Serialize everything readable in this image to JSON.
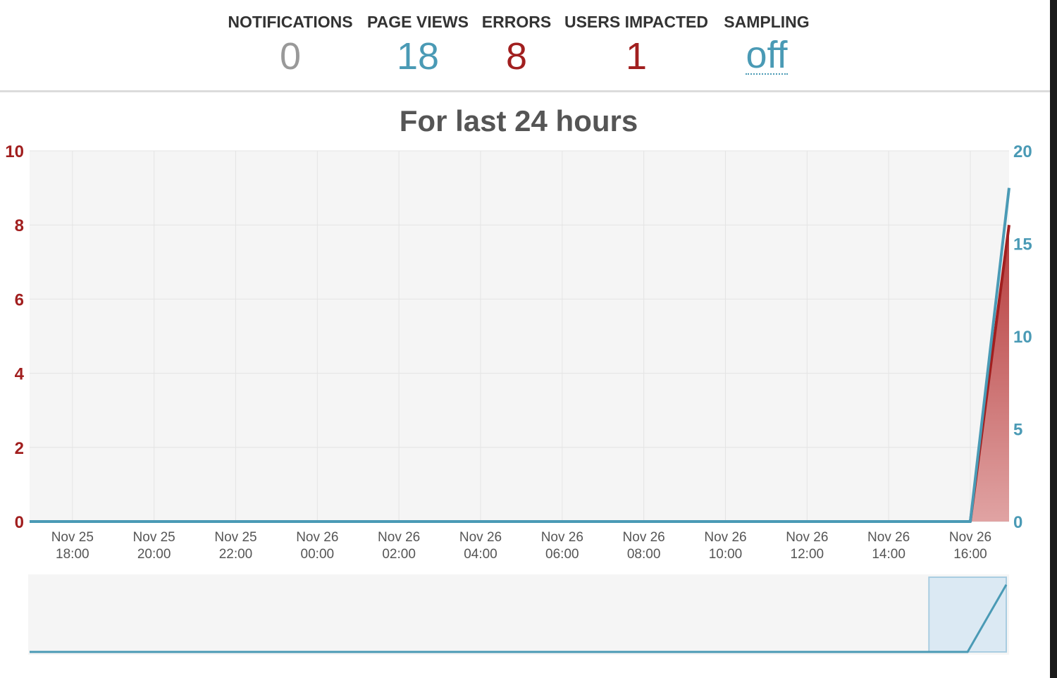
{
  "stats": [
    {
      "label": "NOTIFICATIONS",
      "value": "0",
      "color": "#999999"
    },
    {
      "label": "PAGE VIEWS",
      "value": "18",
      "color": "#4a9ab5"
    },
    {
      "label": "ERRORS",
      "value": "8",
      "color": "#a11f1f"
    },
    {
      "label": "USERS IMPACTED",
      "value": "1",
      "color": "#a11f1f"
    },
    {
      "label": "SAMPLING",
      "value": "off",
      "color": "#4a9ab5"
    }
  ],
  "chart_data": {
    "type": "line",
    "title": "For last 24 hours",
    "x_ticks": [
      [
        "Nov 25",
        "18:00"
      ],
      [
        "Nov 25",
        "20:00"
      ],
      [
        "Nov 25",
        "22:00"
      ],
      [
        "Nov 26",
        "00:00"
      ],
      [
        "Nov 26",
        "02:00"
      ],
      [
        "Nov 26",
        "04:00"
      ],
      [
        "Nov 26",
        "06:00"
      ],
      [
        "Nov 26",
        "08:00"
      ],
      [
        "Nov 26",
        "10:00"
      ],
      [
        "Nov 26",
        "12:00"
      ],
      [
        "Nov 26",
        "14:00"
      ],
      [
        "Nov 26",
        "16:00"
      ]
    ],
    "x_range_hours": [
      -1.05,
      22.95
    ],
    "x": [
      -1.05,
      22.0,
      22.95
    ],
    "y_left": {
      "ticks": [
        "0",
        "2",
        "4",
        "6",
        "8",
        "10"
      ],
      "range": [
        0,
        10
      ],
      "color": "#a11f1f"
    },
    "y_right": {
      "ticks": [
        "0",
        "5",
        "10",
        "15",
        "20"
      ],
      "range": [
        0,
        20
      ],
      "color": "#4a9ab5"
    },
    "series": [
      {
        "values": [
          0,
          0,
          8
        ],
        "axis": "left",
        "color": "#a11f1f",
        "fill": "area"
      },
      {
        "values": [
          0,
          0,
          18
        ],
        "axis": "right",
        "color": "#4a9ab5"
      }
    ],
    "grid": true,
    "navigator": {
      "selection_hours": [
        21.05,
        22.95
      ]
    }
  }
}
